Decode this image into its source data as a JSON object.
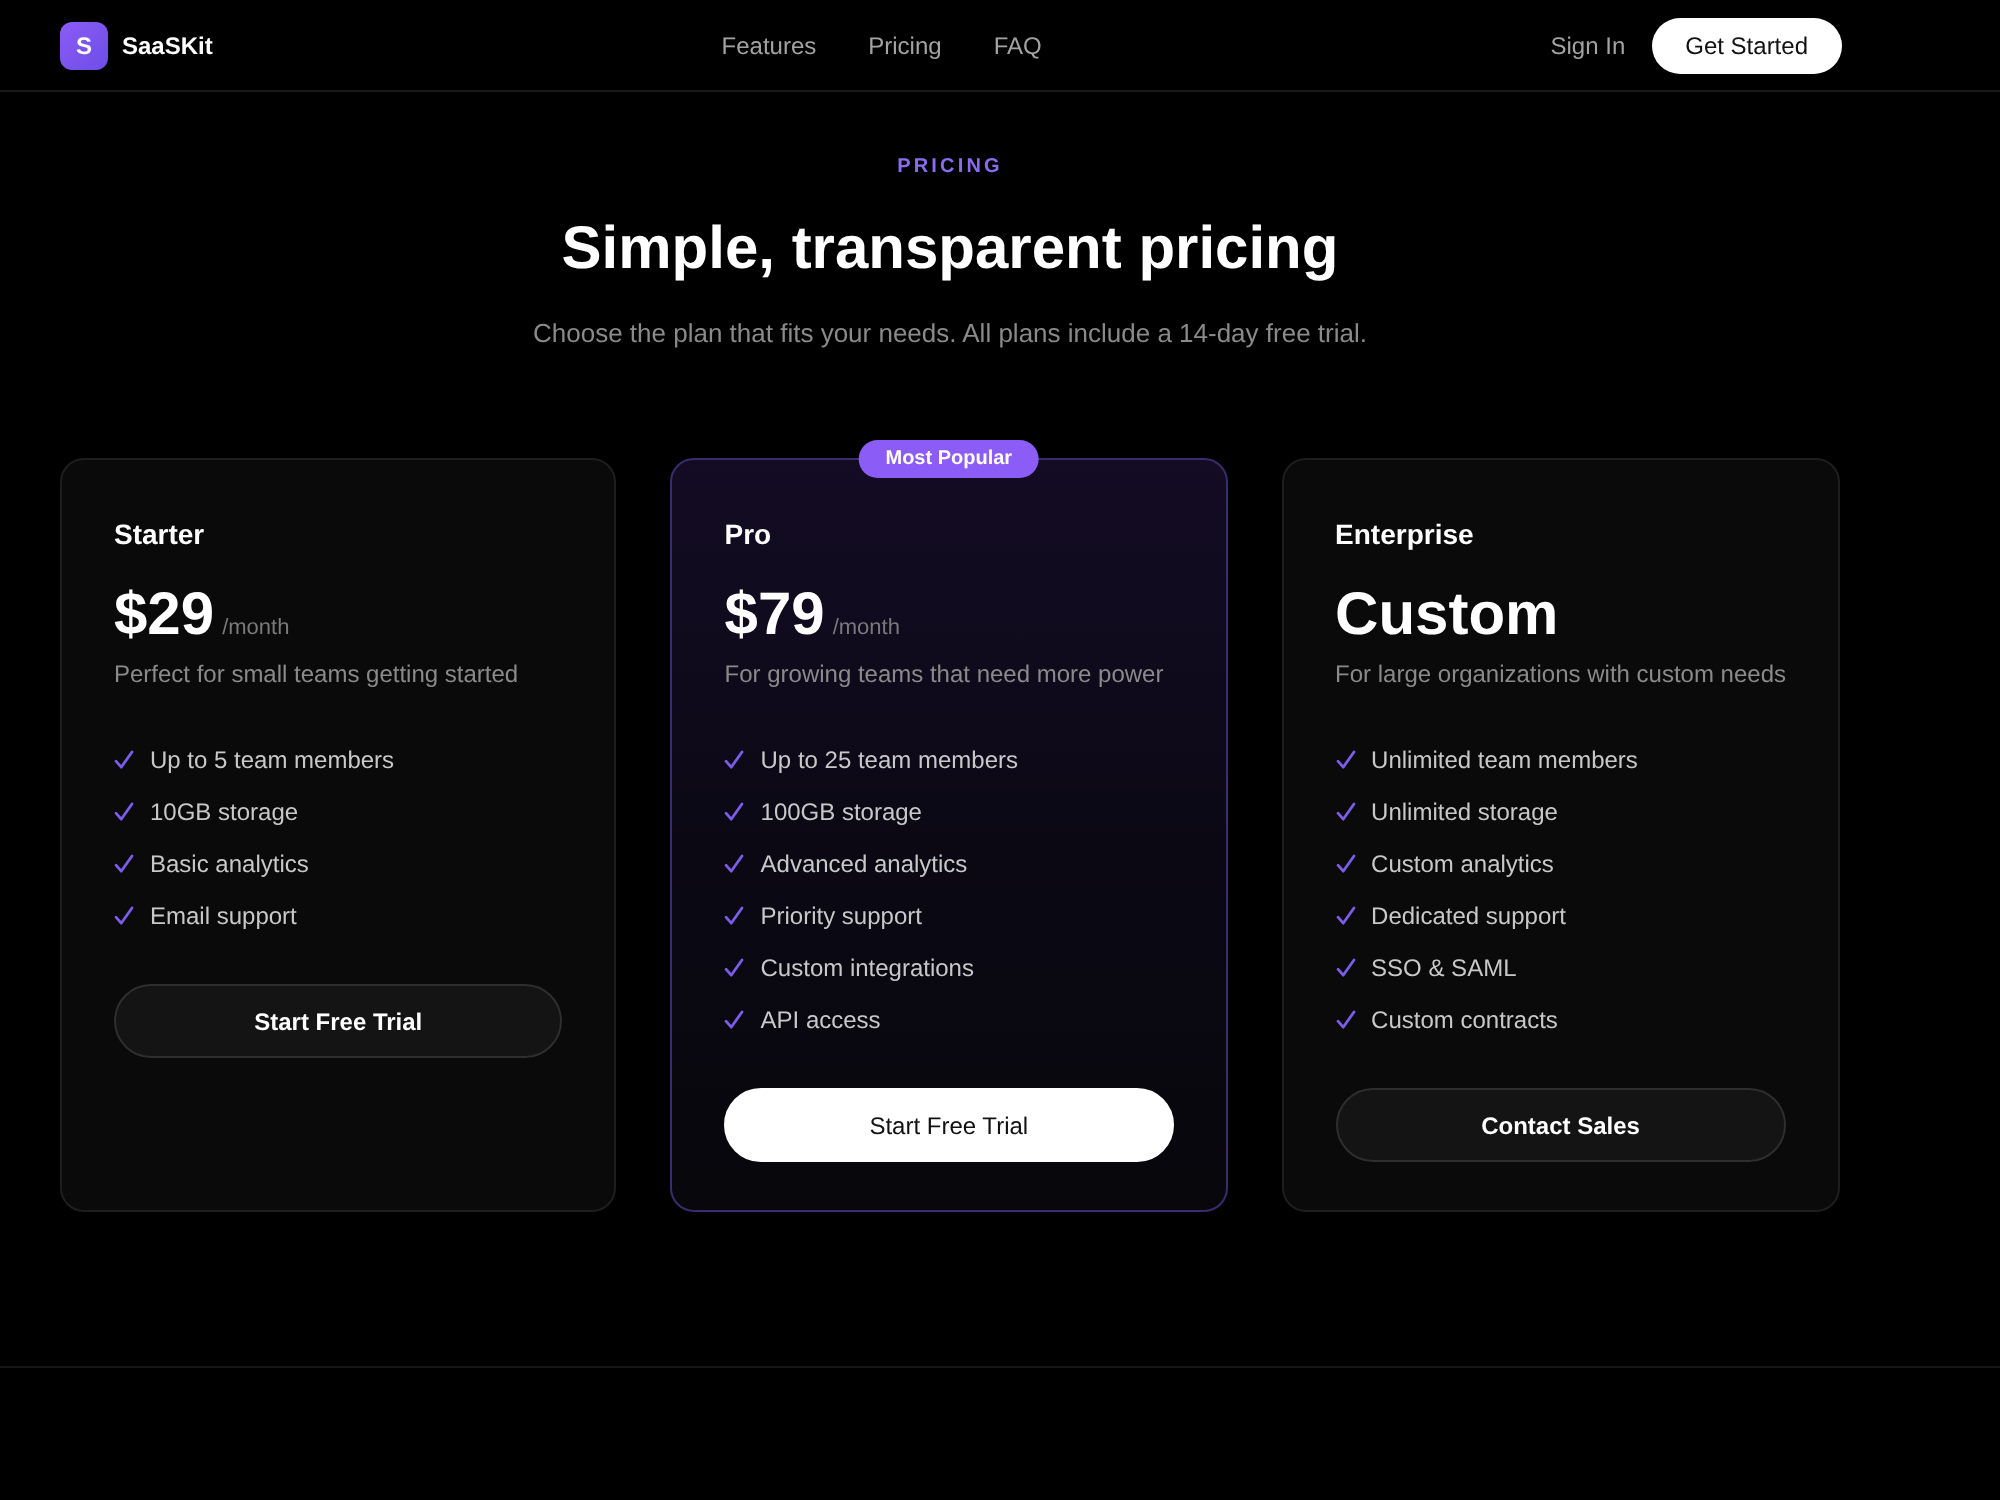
{
  "header": {
    "logo": {
      "letter": "S",
      "name": "SaaSKit"
    },
    "nav": [
      "Features",
      "Pricing",
      "FAQ"
    ],
    "sign_in": "Sign In",
    "cta": "Get Started"
  },
  "hero": {
    "eyebrow": "PRICING",
    "title": "Simple, transparent pricing",
    "subtitle": "Choose the plan that fits your needs. All plans include a 14-day free trial."
  },
  "plans": [
    {
      "name": "Starter",
      "price": "$29",
      "period": "/month",
      "description": "Perfect for small teams getting started",
      "features": [
        "Up to 5 team members",
        "10GB storage",
        "Basic analytics",
        "Email support"
      ],
      "button": "Start Free Trial",
      "highlighted": false
    },
    {
      "name": "Pro",
      "badge": "Most Popular",
      "price": "$79",
      "period": "/month",
      "description": "For growing teams that need more power",
      "features": [
        "Up to 25 team members",
        "100GB storage",
        "Advanced analytics",
        "Priority support",
        "Custom integrations",
        "API access"
      ],
      "button": "Start Free Trial",
      "highlighted": true
    },
    {
      "name": "Enterprise",
      "price": "Custom",
      "description": "For large organizations with custom needs",
      "features": [
        "Unlimited team members",
        "Unlimited storage",
        "Custom analytics",
        "Dedicated support",
        "SSO & SAML",
        "Custom contracts"
      ],
      "button": "Contact Sales",
      "highlighted": false
    }
  ]
}
